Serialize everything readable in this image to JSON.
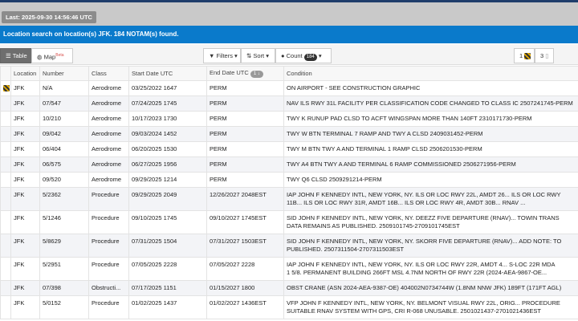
{
  "header": {
    "last_update": "Last: 2025-09-30 14:56:46 UTC",
    "banner": "Location search on location(s) JFK. 184 NOTAM(s) found."
  },
  "toolbar": {
    "table": "Table",
    "map": "Map",
    "map_badge": "Beta",
    "filters": "Filters",
    "sort": "Sort",
    "count": "Count",
    "count_value": "184",
    "right1_count": "1",
    "right2_count": "3"
  },
  "columns": [
    "",
    "Location",
    "Number",
    "Class",
    "Start Date UTC",
    "End Date UTC",
    "Condition"
  ],
  "end_sort_badge": "1 ↓",
  "rows": [
    [
      "JFK",
      "N/A",
      "Aerodrome",
      "03/25/2022 1647",
      "PERM",
      "ON AIRPORT - SEE CONSTRUCTION GRAPHIC",
      ""
    ],
    [
      "JFK",
      "07/547",
      "Aerodrome",
      "07/24/2025 1745",
      "PERM",
      "NAV ILS RWY 31L FACILITY PER CLASSIFICATION CODE CHANGED TO CLASS IC 2507241745-PERM",
      ""
    ],
    [
      "JFK",
      "10/210",
      "Aerodrome",
      "10/17/2023 1730",
      "PERM",
      "TWY K RUNUP PAD CLSD TO ACFT WINGSPAN MORE THAN 140FT 2310171730-PERM",
      ""
    ],
    [
      "JFK",
      "09/042",
      "Aerodrome",
      "09/03/2024 1452",
      "PERM",
      "TWY W BTN TERMINAL 7 RAMP AND TWY A CLSD 2409031452-PERM",
      ""
    ],
    [
      "JFK",
      "06/404",
      "Aerodrome",
      "06/20/2025 1530",
      "PERM",
      "TWY M BTN TWY A AND TERMINAL 1 RAMP CLSD 2506201530-PERM",
      ""
    ],
    [
      "JFK",
      "06/575",
      "Aerodrome",
      "06/27/2025 1956",
      "PERM",
      "TWY A4 BTN TWY A AND TERMINAL 6 RAMP COMMISSIONED 2506271956-PERM",
      ""
    ],
    [
      "JFK",
      "09/520",
      "Aerodrome",
      "09/29/2025 1214",
      "PERM",
      "TWY Q6 CLSD 2509291214-PERM",
      ""
    ],
    [
      "JFK",
      "5/2362",
      "Procedure",
      "09/29/2025 2049",
      "12/26/2027 2048EST",
      "IAP JOHN F KENNEDY INTL, NEW YORK, NY. ILS OR LOC RWY 22L, AMDT 26... ILS OR LOC RWY",
      "11B... ILS OR LOC RWY 31R, AMDT 16B... ILS OR LOC RWY 4R, AMDT 30B... RNAV ..."
    ],
    [
      "JFK",
      "5/1246",
      "Procedure",
      "09/10/2025 1745",
      "09/10/2027 1745EST",
      "SID JOHN F KENNEDY INTL, NEW YORK, NY. DEEZZ FIVE DEPARTURE (RNAV)... TOWIN TRANS",
      "DATA REMAINS AS PUBLISHED. 2509101745-2709101745EST"
    ],
    [
      "JFK",
      "5/8629",
      "Procedure",
      "07/31/2025 1504",
      "07/31/2027 1503EST",
      "SID JOHN F KENNEDY INTL, NEW YORK, NY. SKORR FIVE DEPARTURE (RNAV)... ADD NOTE: TO",
      "PUBLISHED. 2507311504-2707311503EST"
    ],
    [
      "JFK",
      "5/2951",
      "Procedure",
      "07/05/2025 2228",
      "07/05/2027 2228",
      "IAP JOHN F KENNEDY INTL, NEW YORK, NY. ILS OR LOC RWY 22R, AMDT 4... S-LOC 22R MDA",
      "1 5/8. PERMANENT BUILDING 266FT MSL 4.7NM NORTH OF RWY 22R (2024-AEA-9867-OE..."
    ],
    [
      "JFK",
      "07/398",
      "Obstructi...",
      "07/17/2025 1151",
      "01/15/2027 1800",
      "OBST CRANE (ASN 2024-AEA-9387-OE) 404002N0734744W (1.8NM NNW JFK) 189FT (171FT AGL)",
      ""
    ],
    [
      "JFK",
      "5/0152",
      "Procedure",
      "01/02/2025 1437",
      "01/02/2027 1436EST",
      "VFP JOHN F KENNEDY INTL, NEW YORK, NY. BELMONT VISUAL RWY 22L, ORIG... PROCEDURE",
      "SUITABLE RNAV SYSTEM WITH GPS, CRI R-068 UNUSABLE. 2501021437-2701021436EST"
    ]
  ]
}
